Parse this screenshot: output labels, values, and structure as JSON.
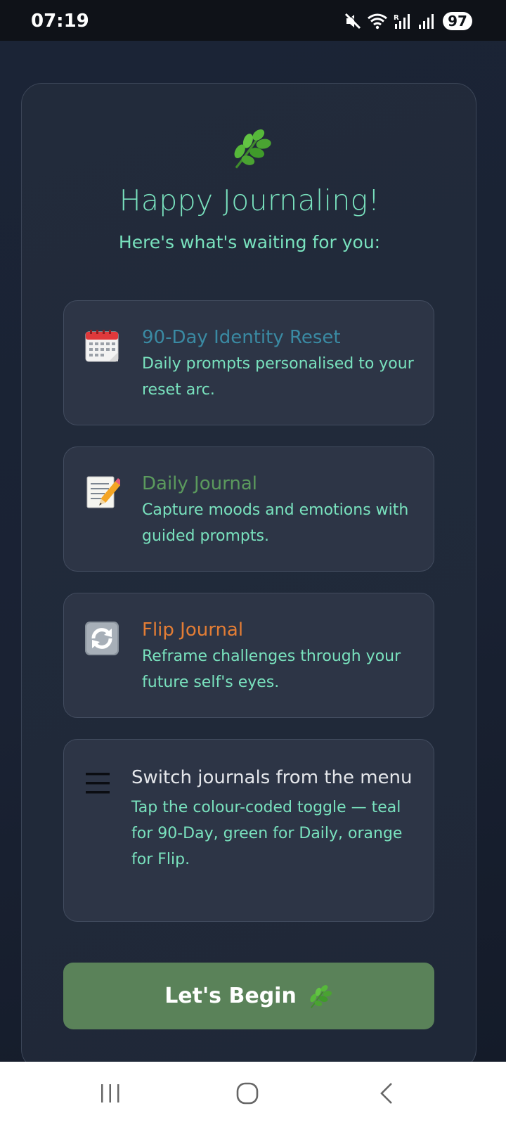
{
  "status_bar": {
    "time": "07:19",
    "battery": "97",
    "icons": [
      "mute-icon",
      "wifi-icon",
      "signal-r-icon",
      "signal-icon"
    ]
  },
  "card": {
    "icon": "herb-leaf-icon",
    "title": "Happy Journaling!",
    "subtitle": "Here's what's waiting for you:"
  },
  "features": [
    {
      "icon": "calendar-icon",
      "title": "90-Day Identity Reset",
      "title_color": "#3a8aa3",
      "description": "Daily prompts personalised to your reset arc."
    },
    {
      "icon": "memo-pencil-icon",
      "title": "Daily Journal",
      "title_color": "#5b9a5d",
      "description": "Capture moods and emotions with guided prompts."
    },
    {
      "icon": "refresh-arrows-icon",
      "title": "Flip Journal",
      "title_color": "#e37d35",
      "description": "Reframe challenges through your future self's eyes."
    },
    {
      "icon": "hamburger-menu-icon",
      "title": "Switch journals from the menu",
      "title_color": "#e4e6ea",
      "description": "Tap the colour-coded toggle — teal for 90-Day, green for Daily, orange for Flip."
    }
  ],
  "begin_button": {
    "label": "Let's Begin",
    "icon": "herb-leaf-icon",
    "color": "#5a8259"
  },
  "colors": {
    "accent_text": "#79e2be",
    "background": "#1a2233",
    "card_surface": "#2d3546"
  },
  "nav_bar": {
    "buttons": [
      "recent-apps-icon",
      "home-icon",
      "back-icon"
    ]
  }
}
